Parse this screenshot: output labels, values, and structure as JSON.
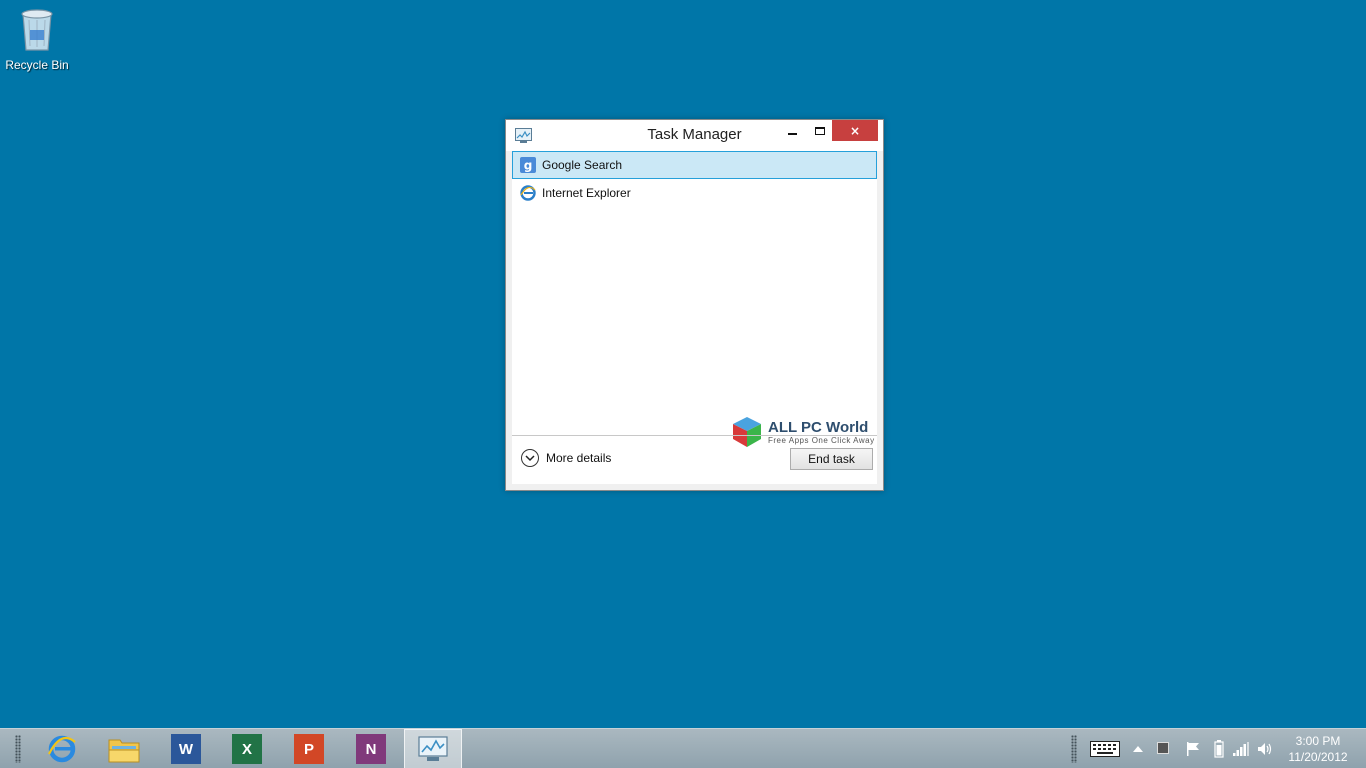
{
  "desktop": {
    "icons": [
      {
        "label": "Recycle Bin",
        "icon": "recycle-bin-icon"
      }
    ]
  },
  "window": {
    "title": "Task Manager",
    "controls": {
      "minimize": "minimize-icon",
      "maximize": "maximize-icon",
      "close": "×"
    },
    "apps": [
      {
        "label": "Google Search",
        "icon": "google-search-icon",
        "selected": true
      },
      {
        "label": "Internet Explorer",
        "icon": "internet-explorer-icon",
        "selected": false
      }
    ],
    "more_details_label": "More details",
    "end_task_label": "End task",
    "selection_color": "#cbe8f6"
  },
  "watermark": {
    "title": "ALL PC World",
    "subtitle": "Free Apps One Click Away"
  },
  "taskbar": {
    "pinned": [
      {
        "name": "internet-explorer",
        "icon": "internet-explorer-icon"
      },
      {
        "name": "file-explorer",
        "icon": "folder-icon"
      },
      {
        "name": "word",
        "icon": "word-icon",
        "color": "#2b579a"
      },
      {
        "name": "excel",
        "icon": "excel-icon",
        "color": "#217346"
      },
      {
        "name": "powerpoint",
        "icon": "powerpoint-icon",
        "color": "#d24726"
      },
      {
        "name": "onenote",
        "icon": "onenote-icon",
        "color": "#80397b"
      },
      {
        "name": "task-manager",
        "icon": "task-manager-icon",
        "active": true
      }
    ],
    "clock": {
      "time": "3:00 PM",
      "date": "11/20/2012"
    }
  },
  "colors": {
    "desktop": "#0076a8",
    "close_button": "#c7403f"
  }
}
